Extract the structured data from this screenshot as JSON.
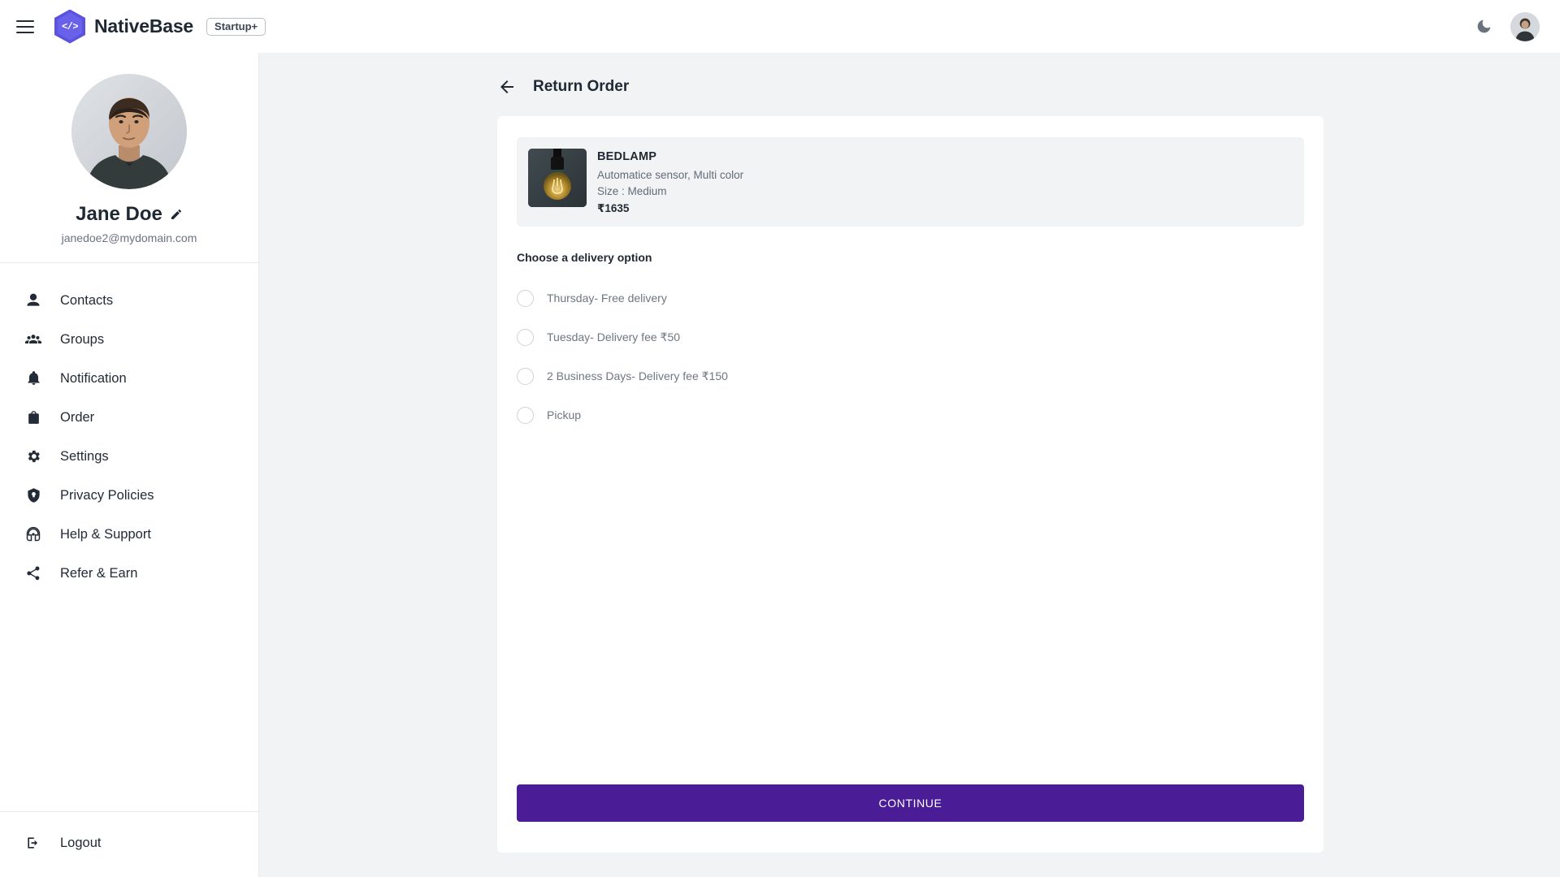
{
  "topbar": {
    "menu_icon": "hamburger-icon",
    "logo_icon": "code-hexagon-logo",
    "logo_glyph": "</>",
    "brand_name": "NativeBase",
    "badge_label": "Startup+",
    "theme_toggle_icon": "moon-icon",
    "avatar_icon": "user-avatar"
  },
  "sidebar": {
    "profile": {
      "avatar_icon": "profile-avatar",
      "name": "Jane Doe",
      "edit_icon": "pencil-icon",
      "email": "janedoe2@mydomain.com"
    },
    "items": [
      {
        "label": "Contacts",
        "icon": "person-icon"
      },
      {
        "label": "Groups",
        "icon": "people-group-icon"
      },
      {
        "label": "Notification",
        "icon": "bell-icon"
      },
      {
        "label": "Order",
        "icon": "shopping-bag-icon"
      },
      {
        "label": "Settings",
        "icon": "gear-icon"
      },
      {
        "label": "Privacy Policies",
        "icon": "shield-icon"
      },
      {
        "label": "Help & Support",
        "icon": "headset-icon"
      },
      {
        "label": "Refer & Earn",
        "icon": "share-icon"
      }
    ],
    "footer": {
      "label": "Logout",
      "icon": "logout-icon"
    }
  },
  "main": {
    "back_icon": "arrow-left-icon",
    "title": "Return Order",
    "product": {
      "image_icon": "edison-bulb-photo",
      "name": "BEDLAMP",
      "description": "Automatice sensor, Multi color",
      "size": "Size : Medium",
      "price": "₹1635"
    },
    "delivery": {
      "section_label": "Choose a delivery option",
      "selected_index": -1,
      "options": [
        {
          "label": "Thursday- Free delivery",
          "selected": false
        },
        {
          "label": "Tuesday- Delivery fee ₹50",
          "selected": false
        },
        {
          "label": "2 Business Days- Delivery fee ₹150",
          "selected": false
        },
        {
          "label": "Pickup",
          "selected": false
        }
      ]
    },
    "continue_label": "CONTINUE"
  },
  "colors": {
    "brand_purple": "#5b52e0",
    "action_purple": "#4a1d96",
    "page_background": "#f2f3f5",
    "card_background": "#ffffff",
    "text_primary": "#1f2933",
    "text_secondary": "#6b7280"
  }
}
